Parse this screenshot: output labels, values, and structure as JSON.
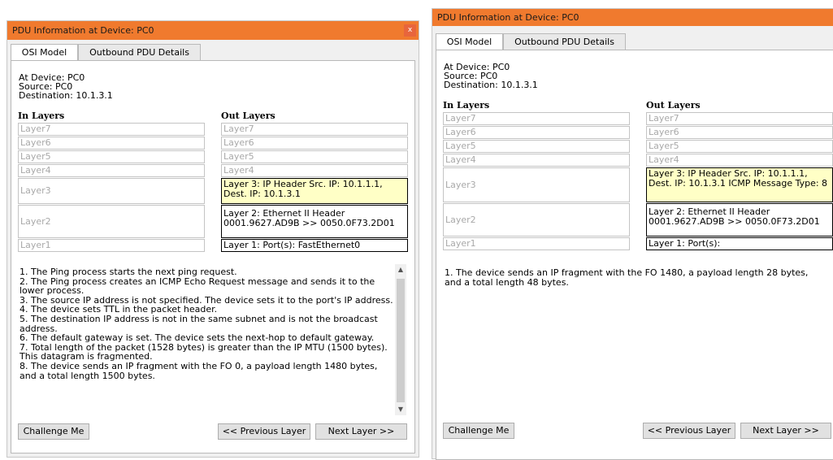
{
  "left": {
    "title": "PDU Information at Device: PC0",
    "close_glyph": "x",
    "tabs": [
      "OSI Model",
      "Outbound PDU Details"
    ],
    "info": [
      "At Device: PC0",
      "Source: PC0",
      "Destination: 10.1.3.1"
    ],
    "in_header": "In Layers",
    "out_header": "Out Layers",
    "in_layers": [
      "Layer7",
      "Layer6",
      "Layer5",
      "Layer4",
      "Layer3",
      "Layer2",
      "Layer1"
    ],
    "out_layers": [
      "Layer7",
      "Layer6",
      "Layer5",
      "Layer4",
      "Layer 3: IP Header Src. IP: 10.1.1.1, Dest. IP: 10.1.3.1",
      "Layer 2: Ethernet II Header 0001.9627.AD9B >> 0050.0F73.2D01",
      "Layer 1: Port(s): FastEthernet0"
    ],
    "description": [
      "1. The Ping process starts the next ping request.",
      "2. The Ping process creates an ICMP Echo Request message and sends it to the lower process.",
      "3. The source IP address is not specified. The device sets it to the port's IP address.",
      "4. The device sets TTL in the packet header.",
      "5. The destination IP address is not in the same subnet and is not the broadcast address.",
      "6. The default gateway is set. The device sets the next-hop to default gateway.",
      "7. Total length of the packet (1528 bytes) is greater than the IP MTU (1500 bytes).    This datagram is fragmented.",
      "8. The device sends an IP fragment with the FO 0, a payload length 1480 bytes, and a total length 1500 bytes."
    ],
    "buttons": {
      "challenge": "Challenge Me",
      "prev": "<< Previous Layer",
      "next": "Next Layer >>"
    }
  },
  "right": {
    "title": "PDU Information at Device: PC0",
    "tabs": [
      "OSI Model",
      "Outbound PDU Details"
    ],
    "info": [
      "At Device: PC0",
      "Source: PC0",
      "Destination: 10.1.3.1"
    ],
    "in_header": "In Layers",
    "out_header": "Out Layers",
    "in_layers": [
      "Layer7",
      "Layer6",
      "Layer5",
      "Layer4",
      "Layer3",
      "Layer2",
      "Layer1"
    ],
    "out_layers": [
      "Layer7",
      "Layer6",
      "Layer5",
      "Layer4",
      "Layer 3: IP Header Src. IP: 10.1.1.1, Dest. IP: 10.1.3.1 ICMP Message Type: 8",
      "Layer 2: Ethernet II Header 0001.9627.AD9B >> 0050.0F73.2D01",
      "Layer 1: Port(s):"
    ],
    "description": [
      "1. The device sends an IP fragment with the FO 1480, a payload length 28 bytes, and a total length 48 bytes."
    ],
    "buttons": {
      "challenge": "Challenge Me",
      "prev": "<< Previous Layer",
      "next": "Next Layer >>"
    }
  }
}
